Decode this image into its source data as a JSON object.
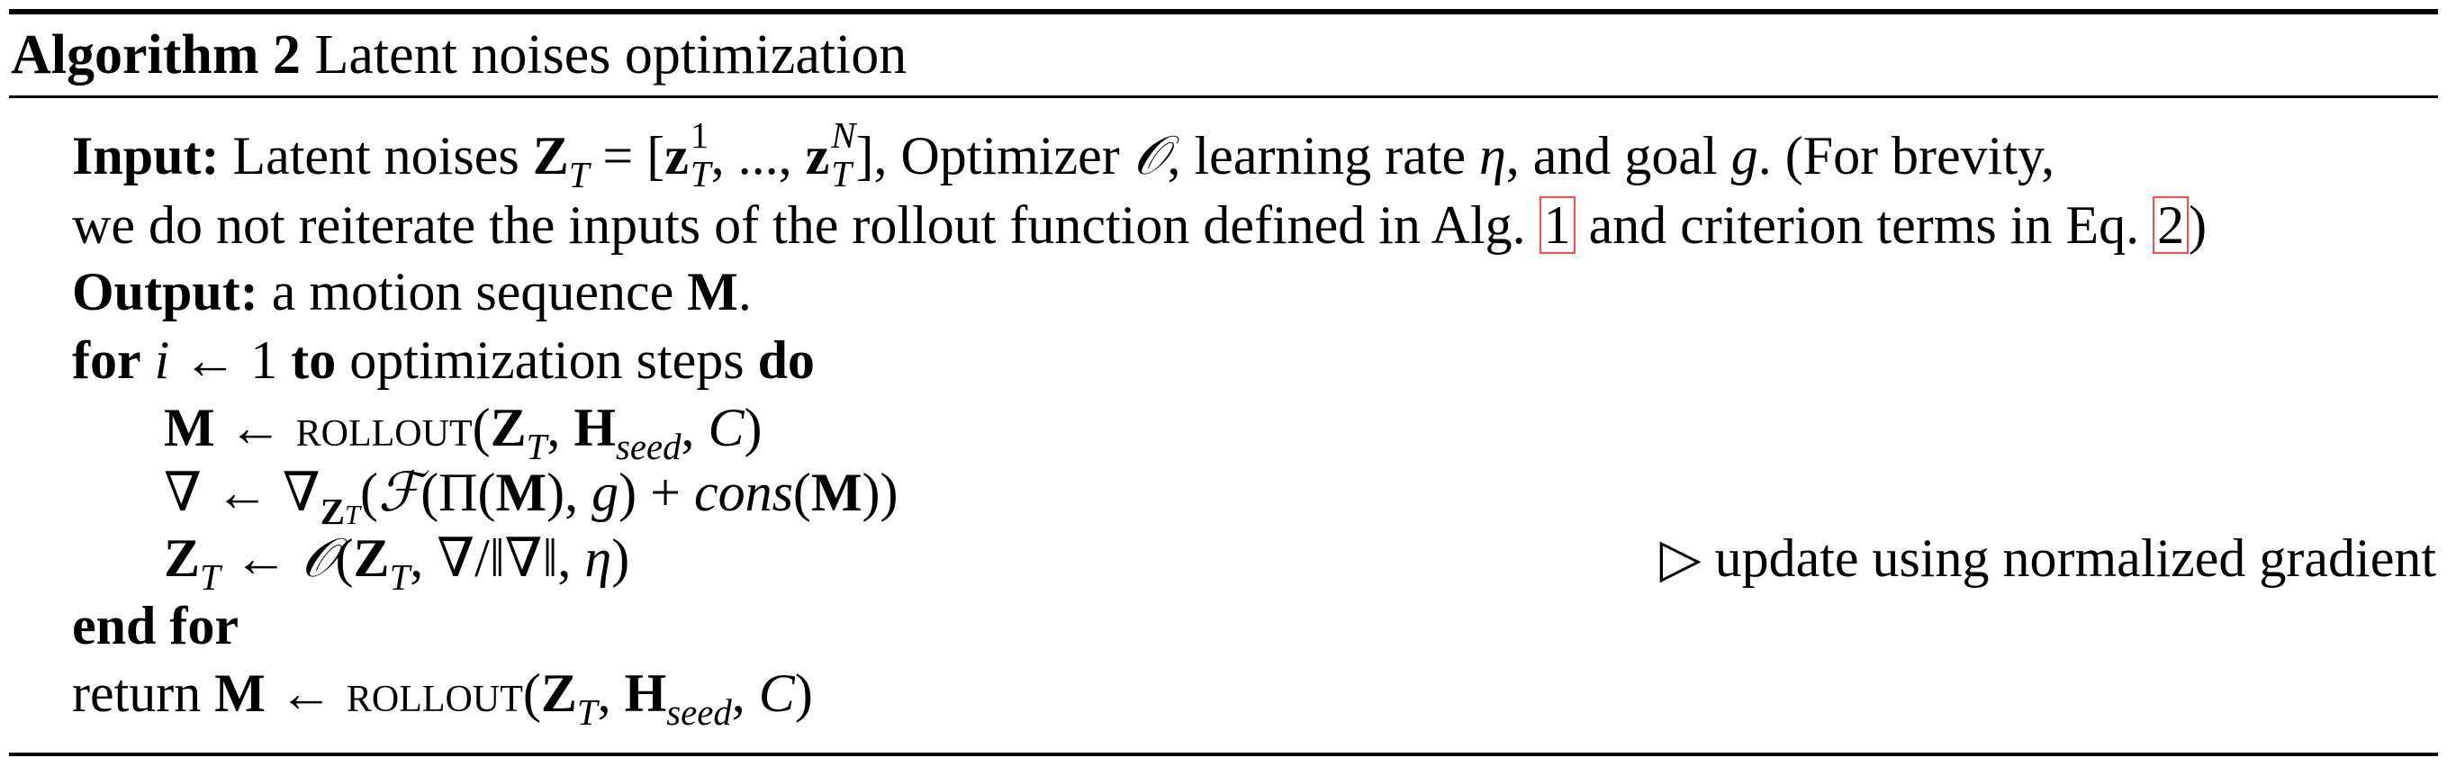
{
  "caption": {
    "algorithm_number": "Algorithm 2",
    "title": "Latent noises optimization"
  },
  "input": {
    "keyword": "Input:",
    "text_a": "Latent noises",
    "text_b": ", Optimizer",
    "text_c": ", learning rate",
    "text_d": ", and goal",
    "text_e": ". (For brevity,",
    "line2_a": "we do not reiterate the inputs of the rollout function defined in Alg.",
    "ref_alg": "1",
    "line2_b": "and criterion terms in Eq.",
    "ref_eq": "2",
    "line2_c": ")"
  },
  "output": {
    "keyword": "Output:",
    "text": "a motion sequence",
    "suffix": "."
  },
  "loop": {
    "for_keyword": "for",
    "var": "i",
    "arrow": "←",
    "start": "1",
    "to_keyword": "to",
    "bound": "optimization steps",
    "do_keyword": "do",
    "end_keyword": "end for"
  },
  "steps": {
    "rollout_fn": "rollout",
    "seed_sub": "seed",
    "cons_fn": "cons",
    "comment": "▷ update using normalized gradient"
  },
  "return": {
    "keyword": "return"
  }
}
